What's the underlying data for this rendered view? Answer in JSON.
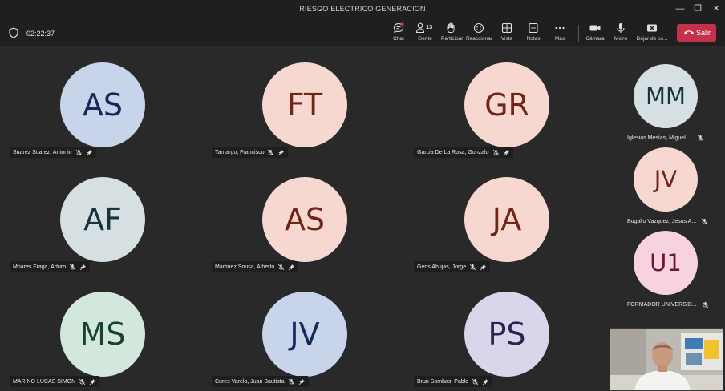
{
  "window": {
    "title": "RIESGO ELECTRICO GENERACION"
  },
  "meeting": {
    "timer": "02:22:37"
  },
  "toolbar": {
    "chat": "Chat",
    "people": "Gente",
    "people_count": "13",
    "raise": "Participar",
    "react": "Reaccionar",
    "view": "Vista",
    "notes": "Notas",
    "more": "Más",
    "camera": "Cámara",
    "mic": "Micro",
    "share": "Dejar de co...",
    "leave": "Salir"
  },
  "participants": [
    {
      "initials": "AS",
      "name": "Suarez Suarez, Antonio",
      "bg": "#c8d4ea",
      "fg": "#13295a"
    },
    {
      "initials": "FT",
      "name": "Tamargo, Francisco",
      "bg": "#f6d8d0",
      "fg": "#6e2717"
    },
    {
      "initials": "GR",
      "name": "Garcia De La Rosa, Gonzalo",
      "bg": "#f6d8d0",
      "fg": "#6e2717"
    },
    {
      "initials": "AF",
      "name": "Moares Fraga, Arturo",
      "bg": "#d6dfe2",
      "fg": "#17333c"
    },
    {
      "initials": "AS",
      "name": "Martinez Sousa, Alberto",
      "bg": "#f6d8d0",
      "fg": "#6e2717"
    },
    {
      "initials": "JA",
      "name": "Gens Abujas, Jorge",
      "bg": "#f6d8d0",
      "fg": "#6e2717"
    },
    {
      "initials": "MS",
      "name": "MARINO LUCAS SIMON",
      "bg": "#d3e8dc",
      "fg": "#17432a"
    },
    {
      "initials": "JV",
      "name": "Cures Varela, Juan Bautista",
      "bg": "#c8d4ea",
      "fg": "#13295a"
    },
    {
      "initials": "PS",
      "name": "Brun Sombas, Pablo",
      "bg": "#d8d6ea",
      "fg": "#28244f"
    }
  ],
  "side_participants": [
    {
      "initials": "MM",
      "name": "Iglesias Mesías, Miguel ...",
      "bg": "#d6dfe2",
      "fg": "#17333c"
    },
    {
      "initials": "JV",
      "name": "Bugallo Vazquez, Jesus A...",
      "bg": "#f6d8d0",
      "fg": "#6e2717"
    },
    {
      "initials": "U1",
      "name": "FORMADOR UNIVERSID...",
      "bg": "#f7d3df",
      "fg": "#6b1a35"
    }
  ],
  "colors": {
    "leave": "#c4314b",
    "background": "#292929",
    "chrome": "#1f1f1f"
  }
}
